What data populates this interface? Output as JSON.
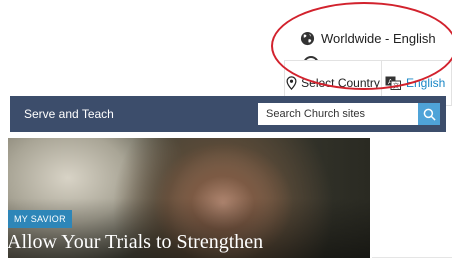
{
  "region": {
    "current_label": "Worldwide - English",
    "current_icon": "globe-icon",
    "select_country_label": "Select Country",
    "select_country_icon": "location-pin-icon",
    "language_label": "English",
    "language_icon": "translate-icon",
    "highlight_color": "#d2222d",
    "link_color": "#1a87c6"
  },
  "nav": {
    "title": "Serve and Teach",
    "search_placeholder": "Search Church sites",
    "search_icon": "search-icon",
    "background_color": "#3c4d6b",
    "search_button_color": "#4fa3d8"
  },
  "hero": {
    "tag": "MY SAVIOR",
    "title": "Allow Your Trials to Strengthen",
    "tag_color": "#2e86b8"
  }
}
